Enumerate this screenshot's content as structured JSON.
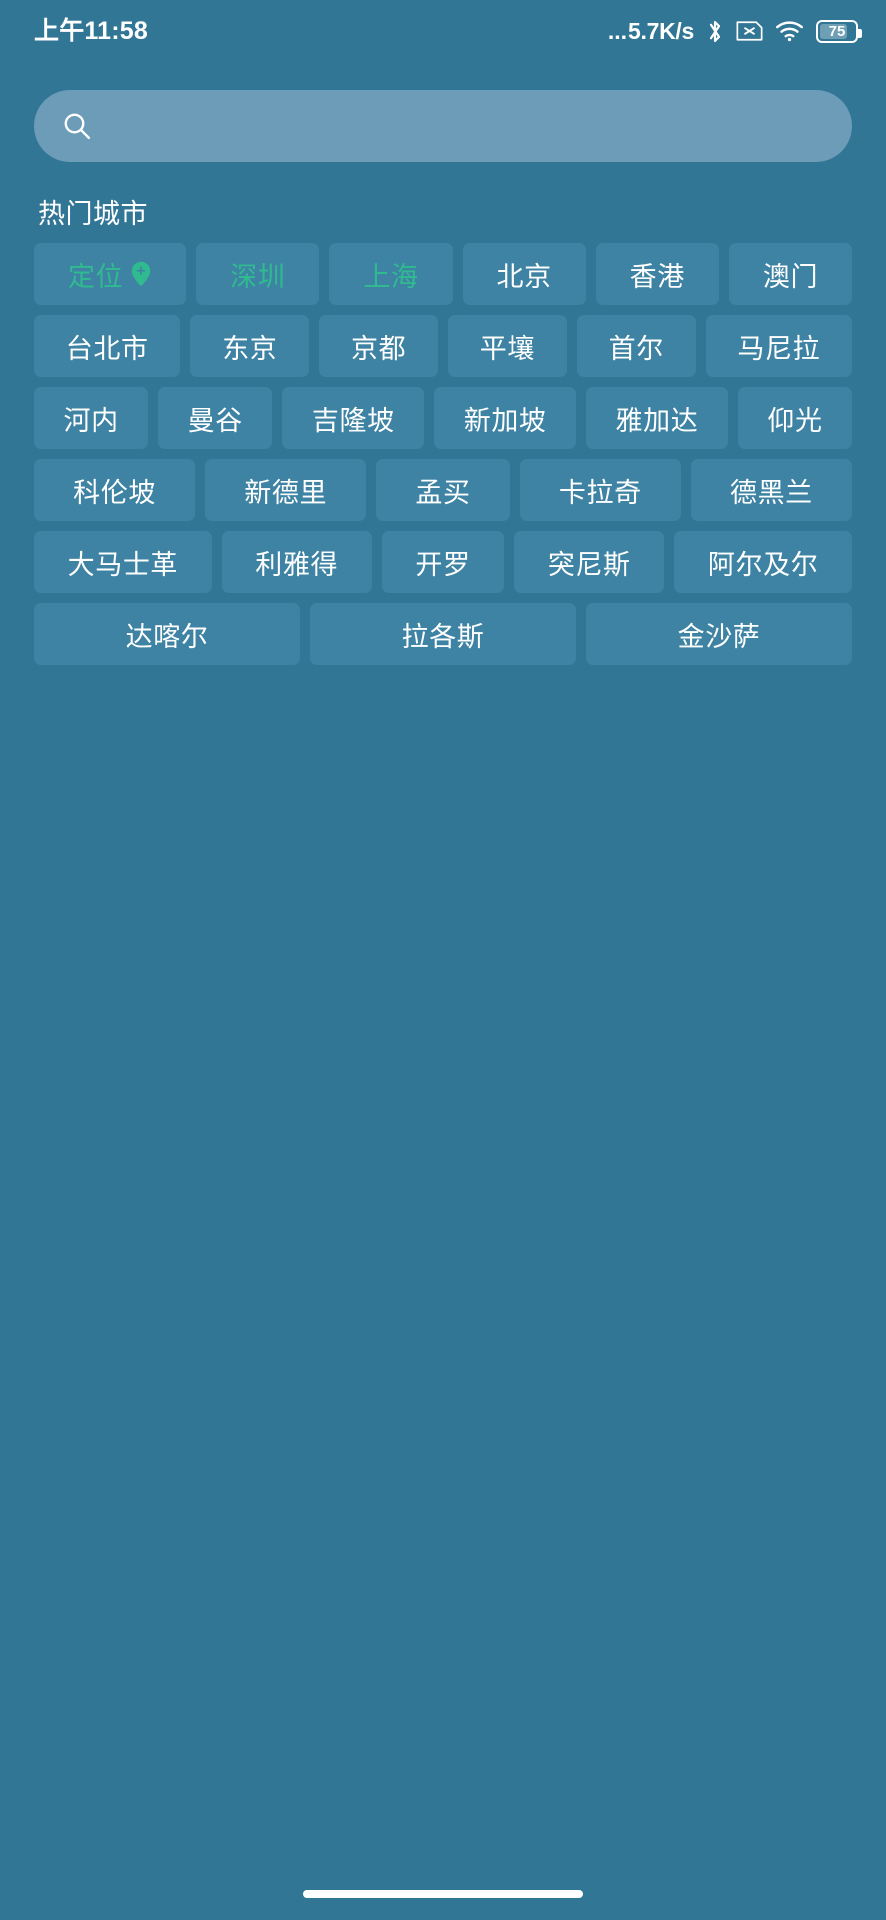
{
  "theme": {
    "background": "#327695",
    "chip_background": "#3E83A3",
    "search_background": "#6C9CB8",
    "accent": "#2FBB8F",
    "text": "#FFFFFF"
  },
  "status_bar": {
    "clock": "上午11:58",
    "net_speed_dots": "...",
    "net_speed": "5.7K/s",
    "bluetooth_icon": "bluetooth-icon",
    "sim_icon": "sim-card-disabled-icon",
    "wifi_icon": "wifi-icon",
    "battery_level": "75"
  },
  "search": {
    "icon": "search-icon",
    "value": "",
    "placeholder": ""
  },
  "section": {
    "title": "热门城市"
  },
  "chip_rows": [
    [
      {
        "label": "定位",
        "accent": true,
        "icon": "location-pin-icon"
      },
      {
        "label": "深圳",
        "accent": true
      },
      {
        "label": "上海",
        "accent": true
      },
      {
        "label": "北京",
        "accent": false
      },
      {
        "label": "香港",
        "accent": false
      },
      {
        "label": "澳门",
        "accent": false
      }
    ],
    [
      {
        "label": "台北市",
        "accent": false
      },
      {
        "label": "东京",
        "accent": false
      },
      {
        "label": "京都",
        "accent": false
      },
      {
        "label": "平壤",
        "accent": false
      },
      {
        "label": "首尔",
        "accent": false
      },
      {
        "label": "马尼拉",
        "accent": false
      }
    ],
    [
      {
        "label": "河内",
        "accent": false
      },
      {
        "label": "曼谷",
        "accent": false
      },
      {
        "label": "吉隆坡",
        "accent": false
      },
      {
        "label": "新加坡",
        "accent": false
      },
      {
        "label": "雅加达",
        "accent": false
      },
      {
        "label": "仰光",
        "accent": false
      }
    ],
    [
      {
        "label": "科伦坡",
        "accent": false
      },
      {
        "label": "新德里",
        "accent": false
      },
      {
        "label": "孟买",
        "accent": false
      },
      {
        "label": "卡拉奇",
        "accent": false
      },
      {
        "label": "德黑兰",
        "accent": false
      }
    ],
    [
      {
        "label": "大马士革",
        "accent": false
      },
      {
        "label": "利雅得",
        "accent": false
      },
      {
        "label": "开罗",
        "accent": false
      },
      {
        "label": "突尼斯",
        "accent": false
      },
      {
        "label": "阿尔及尔",
        "accent": false
      }
    ],
    [
      {
        "label": "达喀尔",
        "accent": false
      },
      {
        "label": "拉各斯",
        "accent": false
      },
      {
        "label": "金沙萨",
        "accent": false
      }
    ]
  ],
  "home_indicator": "home-indicator"
}
